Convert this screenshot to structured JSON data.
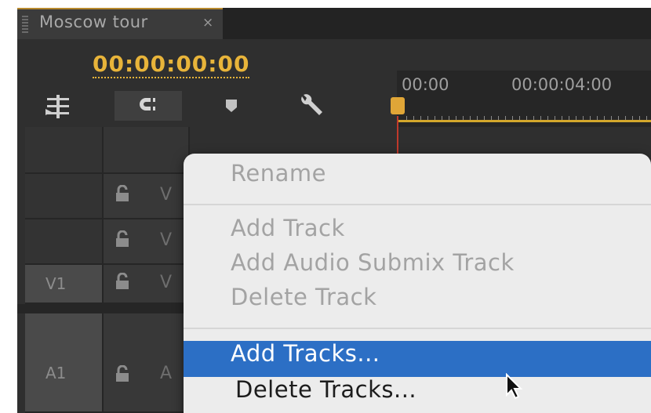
{
  "tab": {
    "title": "Moscow tour",
    "close_glyph": "×"
  },
  "timecode": "00:00:00:00",
  "toolbar": {
    "icons": [
      "insert-track-icon",
      "snap-magnet-icon",
      "marker-icon",
      "wrench-icon"
    ]
  },
  "ruler": {
    "times": [
      "00:00",
      "00:00:04:00"
    ]
  },
  "tracks": {
    "video": [
      {
        "label": "",
        "letter": "V"
      },
      {
        "label": "",
        "letter": "V"
      },
      {
        "label": "V1",
        "letter": "V"
      }
    ],
    "audio": [
      {
        "label": "A1",
        "letter": "A"
      }
    ],
    "lock_glyph": "🔓"
  },
  "context_menu": {
    "items": [
      {
        "label": "Rename",
        "enabled": false
      },
      {
        "label": "Add Track",
        "enabled": false
      },
      {
        "label": "Add Audio Submix Track",
        "enabled": false
      },
      {
        "label": "Delete Track",
        "enabled": false
      },
      {
        "label": "Add Tracks...",
        "enabled": true,
        "highlighted": true
      },
      {
        "label": "Delete Tracks...",
        "enabled": true
      }
    ]
  },
  "colors": {
    "accent_yellow": "#e8b43a",
    "menu_highlight": "#2c6fc5",
    "playhead_red": "#c0392b"
  }
}
